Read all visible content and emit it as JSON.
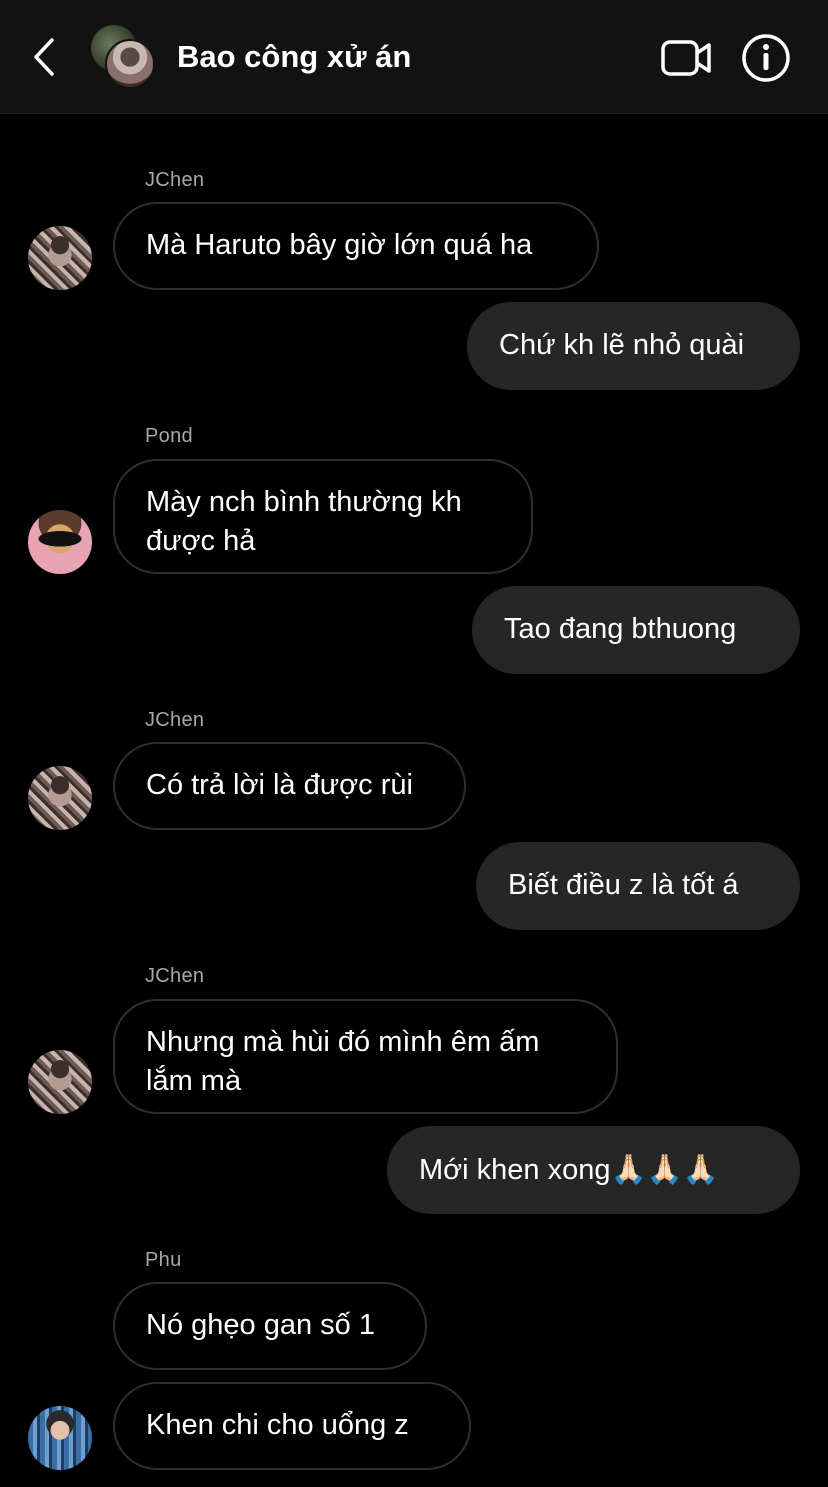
{
  "header": {
    "title": "Bao công xử án",
    "back_icon": "chevron-left-icon",
    "video_icon": "video-camera-icon",
    "info_icon": "info-icon"
  },
  "messages": [
    {
      "type": "incoming",
      "sender": "JChen",
      "lines": [
        "Mà Haruto bây giờ lớn quá ha"
      ]
    },
    {
      "type": "outgoing",
      "lines": [
        "Chứ kh lẽ nhỏ quài"
      ]
    },
    {
      "type": "incoming",
      "sender": "Pond",
      "lines": [
        "Mày nch bình thường kh",
        "được hả"
      ]
    },
    {
      "type": "outgoing",
      "lines": [
        "Tao đang bthuong"
      ]
    },
    {
      "type": "incoming",
      "sender": "JChen",
      "lines": [
        "Có trả lời là được rùi"
      ]
    },
    {
      "type": "outgoing",
      "lines": [
        "Biết điều z là tốt á"
      ]
    },
    {
      "type": "incoming",
      "sender": "JChen",
      "lines": [
        "Nhưng mà hùi đó mình êm ấm",
        "lắm mà"
      ]
    },
    {
      "type": "outgoing",
      "text": "Mới khen xong",
      "emoji": "🙏🏻🙏🏻🙏🏻"
    },
    {
      "type": "incoming",
      "sender": "Phu",
      "lines": [
        "Nó ghẹo gan số 1"
      ]
    },
    {
      "type": "incoming",
      "lines": [
        "Khen chi cho uổng z"
      ]
    }
  ],
  "colors": {
    "background": "#000000",
    "header_bg": "#121212",
    "outgoing_bubble": "#262626",
    "incoming_border": "#2f2f2f",
    "sender_label": "#a8a8a8"
  }
}
